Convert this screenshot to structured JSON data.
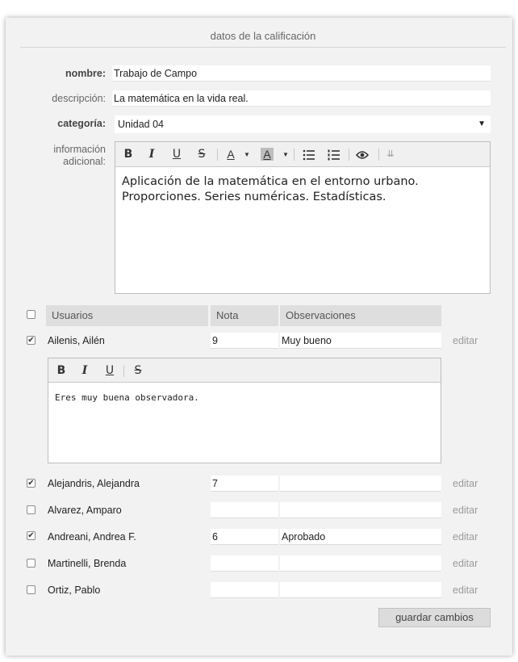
{
  "form": {
    "title": "datos de la calificación",
    "nombre_label": "nombre:",
    "nombre_value": "Trabajo de Campo",
    "descripcion_label": "descripción:",
    "descripcion_value": "La matemática en la vida real.",
    "categoria_label": "categoría:",
    "categoria_value": "Unidad 04",
    "info_label_line1": "información",
    "info_label_line2": "adicional:",
    "info_text_line1": "Aplicación de la matemática en el entorno urbano.",
    "info_text_line2": "Proporciones. Series numéricas. Estadísticas."
  },
  "toolbar": {
    "bold": "B",
    "italic": "I",
    "underline": "U",
    "strike": "S",
    "font_color": "A",
    "highlight": "A",
    "icons": [
      "bold-icon",
      "italic-icon",
      "underline-icon",
      "strikethrough-icon",
      "font-color-icon",
      "highlight-icon",
      "bullet-list-icon",
      "numbered-list-icon",
      "preview-icon",
      "more-icon"
    ]
  },
  "table": {
    "headers": {
      "users": "Usuarios",
      "grade": "Nota",
      "notes": "Observaciones"
    },
    "edit_label": "editar",
    "rows": [
      {
        "name": "Ailenis, Ailén",
        "checked": true,
        "grade": "9",
        "notes": "Muy bueno"
      },
      {
        "name": "Alejandris, Alejandra",
        "checked": true,
        "grade": "7",
        "notes": ""
      },
      {
        "name": "Alvarez, Amparo",
        "checked": false,
        "grade": "",
        "notes": ""
      },
      {
        "name": "Andreani, Andrea F.",
        "checked": true,
        "grade": "6",
        "notes": "Aprobado"
      },
      {
        "name": "Martinelli, Brenda",
        "checked": false,
        "grade": "",
        "notes": ""
      },
      {
        "name": "Ortiz, Pablo",
        "checked": false,
        "grade": "",
        "notes": ""
      }
    ],
    "expanded_comment": "Eres muy buena observadora."
  },
  "actions": {
    "save_label": "guardar cambios"
  },
  "colors": {
    "panel": "#f2f2f2",
    "header": "#dedede",
    "link": "#9a9a9a"
  }
}
